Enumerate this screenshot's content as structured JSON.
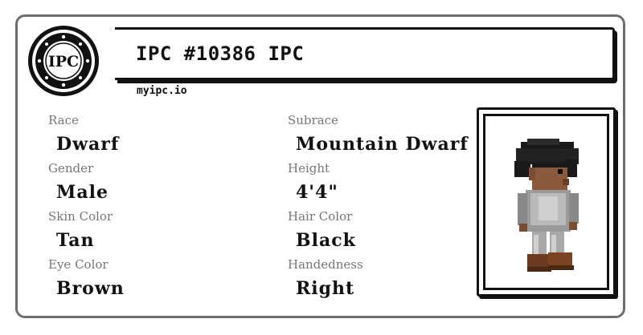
{
  "header": {
    "title": "IPC #10386 IPC",
    "site": "myipc.io",
    "logo_text": "IPC"
  },
  "attributes": {
    "race": {
      "label": "Race",
      "value": "Dwarf"
    },
    "subrace": {
      "label": "Subrace",
      "value": "Mountain Dwarf"
    },
    "gender": {
      "label": "Gender",
      "value": "Male"
    },
    "height": {
      "label": "Height",
      "value": "4'4\""
    },
    "skin_color": {
      "label": "Skin Color",
      "value": "Tan"
    },
    "hair_color": {
      "label": "Hair Color",
      "value": "Black"
    },
    "eye_color": {
      "label": "Eye Color",
      "value": "Brown"
    },
    "handedness": {
      "label": "Handedness",
      "value": "Right"
    }
  },
  "colors": {
    "card_border": "#6e6e6e",
    "label": "#767676",
    "value": "#111111"
  },
  "icons": {
    "logo": "ipc-logo-icon",
    "portrait": "pixel-dwarf-character"
  }
}
